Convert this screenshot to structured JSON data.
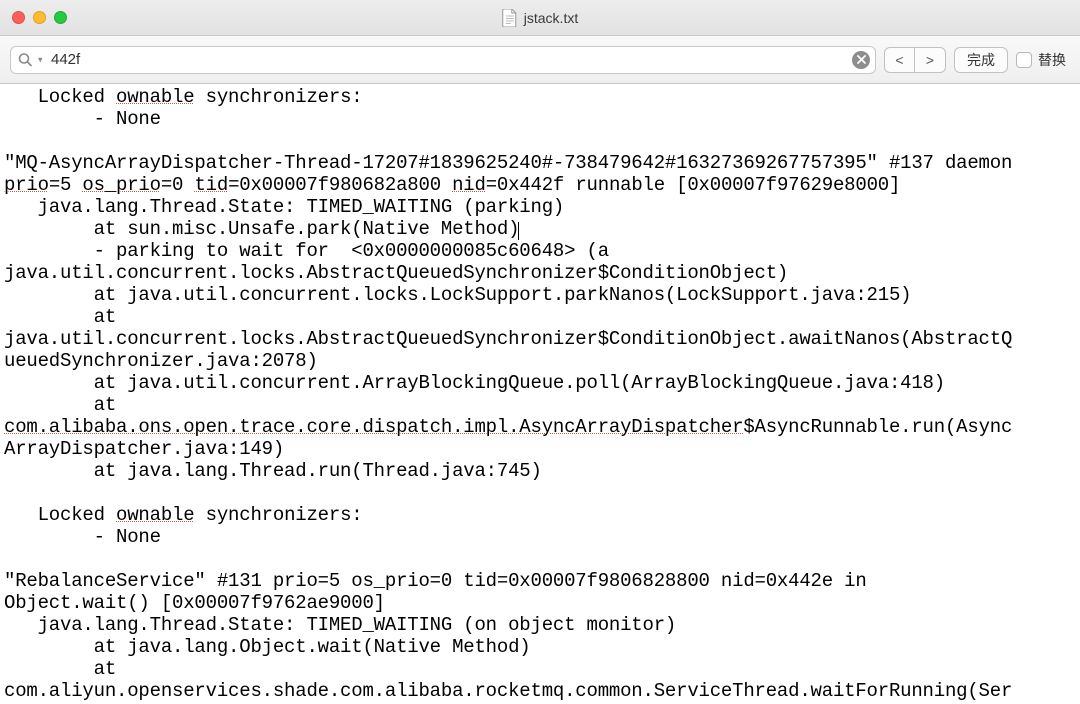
{
  "window": {
    "title": "jstack.txt"
  },
  "toolbar": {
    "search_value": "442f",
    "prev_label": "<",
    "next_label": ">",
    "done_label": "完成",
    "replace_label": "替换"
  },
  "content": {
    "l01_a": "   Locked ",
    "l01_b": "ownable",
    "l01_c": " synchronizers:",
    "l02": "        - None",
    "l03": "",
    "l04": "\"MQ-AsyncArrayDispatcher-Thread-17207#1839625240#-738479642#16327369267757395\" #137 daemon ",
    "l05_a": "prio",
    "l05_b": "=5 ",
    "l05_c": "os_prio",
    "l05_d": "=0 ",
    "l05_e": "tid",
    "l05_f": "=0x00007f980682a800 ",
    "l05_g": "nid",
    "l05_h": "=0x442f runnable [0x00007f97629e8000]",
    "l06": "   java.lang.Thread.State: TIMED_WAITING (parking)",
    "l07": "        at sun.misc.Unsafe.park(Native Method)",
    "l08": "        - parking to wait for  <0x0000000085c60648> (a ",
    "l09": "java.util.concurrent.locks.AbstractQueuedSynchronizer$ConditionObject)",
    "l10": "        at java.util.concurrent.locks.LockSupport.parkNanos(LockSupport.java:215)",
    "l11": "        at ",
    "l12": "java.util.concurrent.locks.AbstractQueuedSynchronizer$ConditionObject.awaitNanos(AbstractQ",
    "l13": "ueuedSynchronizer.java:2078)",
    "l14": "        at java.util.concurrent.ArrayBlockingQueue.poll(ArrayBlockingQueue.java:418)",
    "l15": "        at ",
    "l16_a": "com.alibaba.ons.open.trace.core.dispatch.impl.AsyncArrayDispatcher",
    "l16_b": "$AsyncRunnable.run(Async",
    "l17": "ArrayDispatcher.java:149)",
    "l18": "        at java.lang.Thread.run(Thread.java:745)",
    "l19": "",
    "l20_a": "   Locked ",
    "l20_b": "ownable",
    "l20_c": " synchronizers:",
    "l21": "        - None",
    "l22": "",
    "l23": "\"RebalanceService\" #131 prio=5 os_prio=0 tid=0x00007f9806828800 nid=0x442e in ",
    "l24": "Object.wait() [0x00007f9762ae9000]",
    "l25": "   java.lang.Thread.State: TIMED_WAITING (on object monitor)",
    "l26": "        at java.lang.Object.wait(Native Method)",
    "l27": "        at ",
    "l28": "com.aliyun.openservices.shade.com.alibaba.rocketmq.common.ServiceThread.waitForRunning(Ser"
  }
}
